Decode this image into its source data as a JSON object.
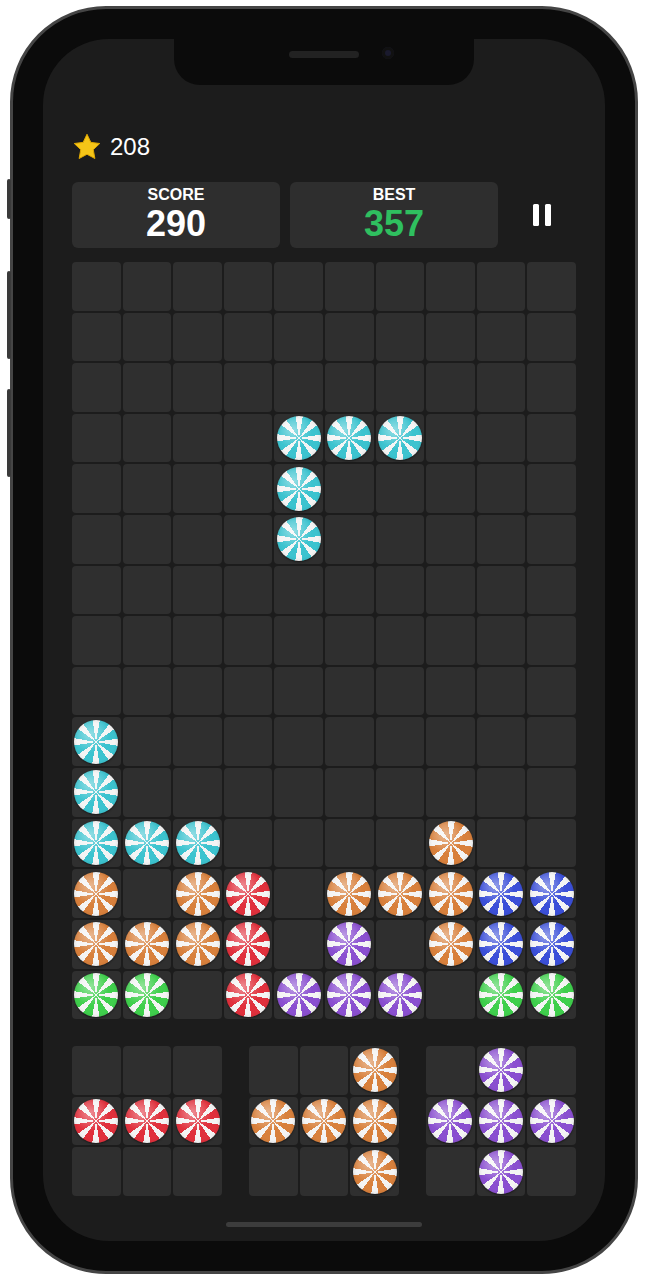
{
  "stars": "208",
  "score": {
    "label": "SCORE",
    "value": "290"
  },
  "best": {
    "label": "BEST",
    "value": "357"
  },
  "board": {
    "rows": [
      [
        null,
        null,
        null,
        null,
        null,
        null,
        null,
        null,
        null,
        null
      ],
      [
        null,
        null,
        null,
        null,
        null,
        null,
        null,
        null,
        null,
        null
      ],
      [
        null,
        null,
        null,
        null,
        null,
        null,
        null,
        null,
        null,
        null
      ],
      [
        null,
        null,
        null,
        null,
        "#3cc3cf",
        "#3cc3cf",
        "#3cc3cf",
        null,
        null,
        null
      ],
      [
        null,
        null,
        null,
        null,
        "#3cc3cf",
        null,
        null,
        null,
        null,
        null
      ],
      [
        null,
        null,
        null,
        null,
        "#3cc3cf",
        null,
        null,
        null,
        null,
        null
      ],
      [
        null,
        null,
        null,
        null,
        null,
        null,
        null,
        null,
        null,
        null
      ],
      [
        null,
        null,
        null,
        null,
        null,
        null,
        null,
        null,
        null,
        null
      ],
      [
        null,
        null,
        null,
        null,
        null,
        null,
        null,
        null,
        null,
        null
      ],
      [
        "#3cc3cf",
        null,
        null,
        null,
        null,
        null,
        null,
        null,
        null,
        null
      ],
      [
        "#3cc3cf",
        null,
        null,
        null,
        null,
        null,
        null,
        null,
        null,
        null
      ],
      [
        "#3cc3cf",
        "#3cc3cf",
        "#3cc3cf",
        null,
        null,
        null,
        null,
        "#d8803c",
        null,
        null
      ],
      [
        "#d8803c",
        null,
        "#d8803c",
        "#e0303c",
        null,
        "#d8803c",
        "#d8803c",
        "#d8803c",
        "#3b4fd8",
        "#3b4fd8"
      ],
      [
        "#d8803c",
        "#d8803c",
        "#d8803c",
        "#e0303c",
        null,
        "#8a4fd0",
        null,
        "#d8803c",
        "#3b4fd8",
        "#3b4fd8"
      ],
      [
        "#3fcf4c",
        "#3fcf4c",
        null,
        "#e0303c",
        "#8a4fd0",
        "#8a4fd0",
        "#8a4fd0",
        null,
        "#3fcf4c",
        "#3fcf4c"
      ]
    ]
  },
  "tray": [
    {
      "rows": [
        [
          null,
          null,
          null
        ],
        [
          "#e0303c",
          "#e0303c",
          "#e0303c"
        ],
        [
          null,
          null,
          null
        ]
      ]
    },
    {
      "rows": [
        [
          null,
          null,
          "#d8803c"
        ],
        [
          "#d8803c",
          "#d8803c",
          "#d8803c"
        ],
        [
          null,
          null,
          "#d8803c"
        ]
      ]
    },
    {
      "rows": [
        [
          null,
          "#8a4fd0",
          null
        ],
        [
          "#8a4fd0",
          "#8a4fd0",
          "#8a4fd0"
        ],
        [
          null,
          "#8a4fd0",
          null
        ]
      ]
    }
  ]
}
